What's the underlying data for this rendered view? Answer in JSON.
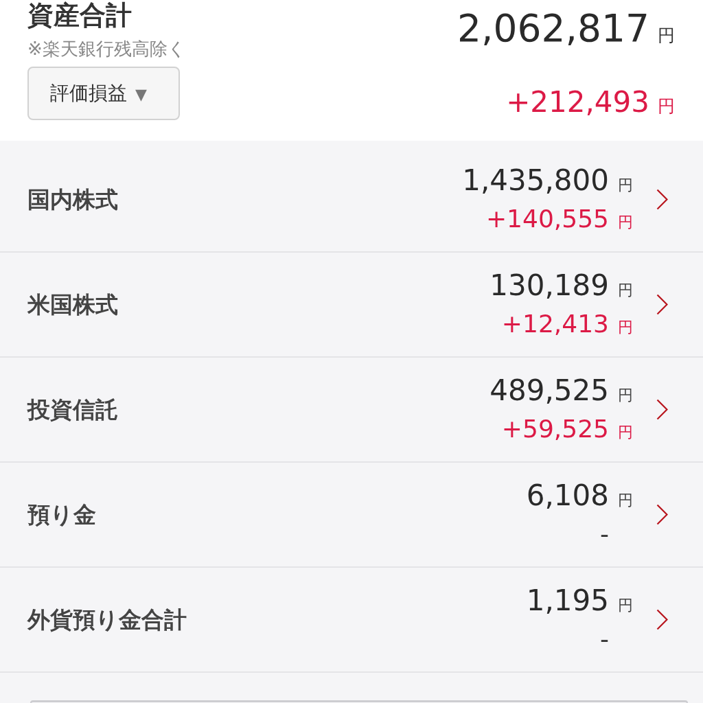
{
  "summary": {
    "title": "資産合計",
    "note": "※楽天銀行残高除く",
    "dropdown": {
      "label": "評価損益",
      "caret": "▼"
    },
    "total": {
      "value": "2,062,817",
      "unit": "円"
    },
    "gain": {
      "value": "+212,493",
      "unit": "円"
    }
  },
  "categories": [
    {
      "label": "国内株式",
      "value": "1,435,800",
      "value_unit": "円",
      "change": {
        "text": "+140,555",
        "unit": "円",
        "color": "#dc1a46"
      }
    },
    {
      "label": "米国株式",
      "value": "130,189",
      "value_unit": "円",
      "change": {
        "text": "+12,413",
        "unit": "円",
        "color": "#dc1a46"
      }
    },
    {
      "label": "投資信託",
      "value": "489,525",
      "value_unit": "円",
      "change": {
        "text": "+59,525",
        "unit": "円",
        "color": "#dc1a46"
      }
    },
    {
      "label": "預り金",
      "value": "6,108",
      "value_unit": "円",
      "change": {
        "text": "-",
        "color": "#333333"
      }
    },
    {
      "label": "外貨預り金合計",
      "value": "1,195",
      "value_unit": "円",
      "change": {
        "text": "-",
        "color": "#333333"
      }
    }
  ]
}
